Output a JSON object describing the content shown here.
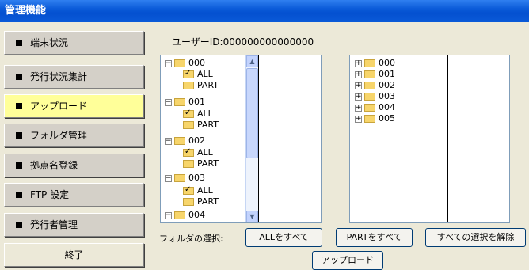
{
  "window": {
    "title": "管理機能"
  },
  "sidebar": {
    "items": [
      {
        "label": "端末状況"
      },
      {
        "label": "発行状況集計"
      },
      {
        "label": "アップロード"
      },
      {
        "label": "フォルダ管理"
      },
      {
        "label": "拠点名登録"
      },
      {
        "label": "FTP 設定"
      },
      {
        "label": "発行者管理"
      }
    ],
    "exit_label": "終了"
  },
  "main": {
    "user_id": "ユーザーID:000000000000000",
    "left_tree": [
      {
        "label": "000",
        "children": [
          "ALL",
          "PART"
        ]
      },
      {
        "label": "001",
        "children": [
          "ALL",
          "PART"
        ]
      },
      {
        "label": "002",
        "children": [
          "ALL",
          "PART"
        ]
      },
      {
        "label": "003",
        "children": [
          "ALL",
          "PART"
        ]
      },
      {
        "label": "004"
      }
    ],
    "right_tree": [
      "000",
      "001",
      "002",
      "003",
      "004",
      "005"
    ],
    "folder_select_label": "フォルダの選択:",
    "btn_all": "ALLをすべて",
    "btn_part": "PARTをすべて",
    "btn_clear": "すべての選択を解除",
    "btn_upload": "アップロード"
  }
}
